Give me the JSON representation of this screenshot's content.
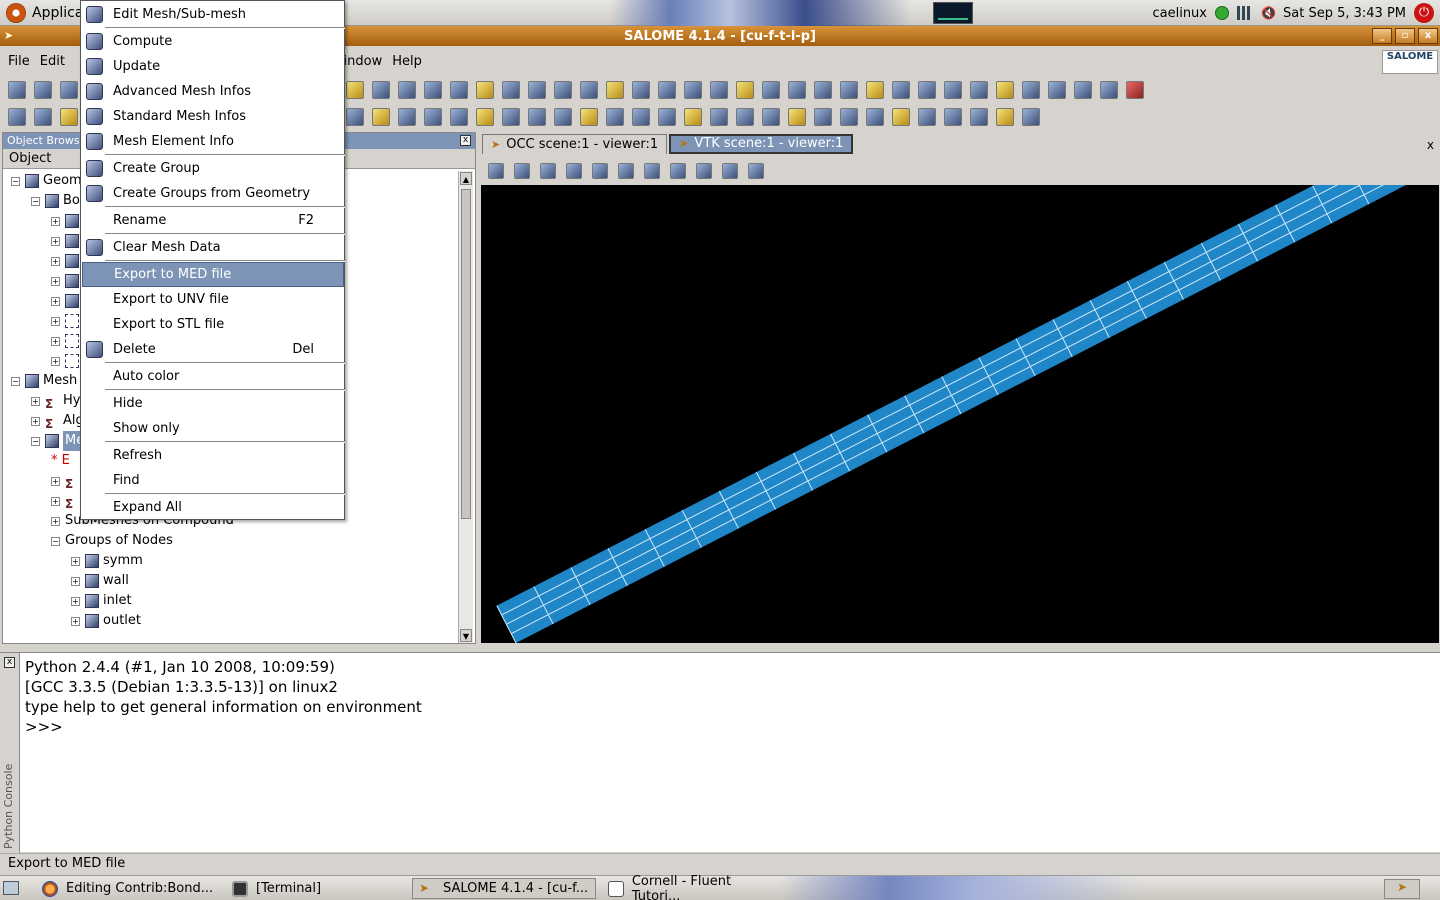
{
  "top_panel": {
    "applications_label": "Applications",
    "user": "caelinux",
    "clock": "Sat Sep  5,  3:43 PM"
  },
  "window": {
    "title": "SALOME 4.1.4 - [cu-f-t-l-p]",
    "buttons": [
      "_",
      "▫",
      "x"
    ]
  },
  "menubar": {
    "items": [
      "File",
      "Edit",
      "Window",
      "Help"
    ],
    "logo_text": "SALOME"
  },
  "object_browser": {
    "title": "Object Browser",
    "header": "Object",
    "tree": [
      {
        "label": "Geom",
        "indent": 0,
        "exp": "−",
        "icon": "geom"
      },
      {
        "label": "Box",
        "indent": 1,
        "exp": "−",
        "icon": "box"
      },
      {
        "label": "",
        "indent": 2,
        "exp": "+",
        "icon": "solid"
      },
      {
        "label": "",
        "indent": 2,
        "exp": "+",
        "icon": "solid"
      },
      {
        "label": "",
        "indent": 2,
        "exp": "+",
        "icon": "solid"
      },
      {
        "label": "",
        "indent": 2,
        "exp": "+",
        "icon": "solid"
      },
      {
        "label": "",
        "indent": 2,
        "exp": "+",
        "icon": "solid"
      },
      {
        "label": "",
        "indent": 2,
        "exp": "+",
        "icon": "dash"
      },
      {
        "label": "",
        "indent": 2,
        "exp": "+",
        "icon": "dash"
      },
      {
        "label": "",
        "indent": 2,
        "exp": "+",
        "icon": "dash"
      },
      {
        "label": "Mesh",
        "indent": 0,
        "exp": "−",
        "icon": "mesh"
      },
      {
        "label": "Hyp",
        "indent": 1,
        "exp": "+",
        "icon": "hyp"
      },
      {
        "label": "Alg",
        "indent": 1,
        "exp": "+",
        "icon": "hyp"
      },
      {
        "label": "Me",
        "indent": 1,
        "exp": "−",
        "icon": "mesh",
        "selected": true
      },
      {
        "label": "* E",
        "indent": 2,
        "exp": "",
        "icon": "none",
        "red": true
      },
      {
        "label": "",
        "indent": 2,
        "exp": "+",
        "icon": "hyp"
      },
      {
        "label": "",
        "indent": 2,
        "exp": "+",
        "icon": "hyp"
      },
      {
        "label": "SubMeshes on Compound",
        "indent": 2,
        "exp": "+",
        "icon": "none"
      },
      {
        "label": "Groups of Nodes",
        "indent": 2,
        "exp": "−",
        "icon": "none"
      },
      {
        "label": "symm",
        "indent": 3,
        "exp": "+",
        "icon": "mesh"
      },
      {
        "label": "wall",
        "indent": 3,
        "exp": "+",
        "icon": "mesh"
      },
      {
        "label": "inlet",
        "indent": 3,
        "exp": "+",
        "icon": "mesh"
      },
      {
        "label": "outlet",
        "indent": 3,
        "exp": "+",
        "icon": "mesh"
      }
    ]
  },
  "viewer": {
    "tabs": [
      {
        "label": "OCC scene:1 - viewer:1",
        "active": false
      },
      {
        "label": "VTK scene:1 - viewer:1",
        "active": true
      }
    ],
    "close_label": "x",
    "mesh_color": "#1f86c8",
    "background": "#000000"
  },
  "context_menu": {
    "items": [
      {
        "label": "Edit Mesh/Sub-mesh",
        "icon": "edit-mesh-icon"
      },
      {
        "sep": true
      },
      {
        "label": "Compute",
        "icon": "compute-icon"
      },
      {
        "label": "Update",
        "icon": "update-icon"
      },
      {
        "label": "Advanced Mesh Infos",
        "icon": "advanced-info-icon"
      },
      {
        "label": "Standard Mesh Infos",
        "icon": "standard-info-icon"
      },
      {
        "label": "Mesh Element Info",
        "icon": "element-info-icon"
      },
      {
        "sep": true
      },
      {
        "label": "Create Group",
        "icon": "create-group-icon"
      },
      {
        "label": "Create Groups from Geometry",
        "icon": "groups-geometry-icon"
      },
      {
        "sep": true
      },
      {
        "label": "Rename",
        "accel": "F2"
      },
      {
        "sep": true
      },
      {
        "label": "Clear Mesh Data",
        "icon": "clear-mesh-icon"
      },
      {
        "sep": true
      },
      {
        "label": "Export to MED file",
        "highlight": true
      },
      {
        "label": "Export to UNV file"
      },
      {
        "label": "Export to STL file"
      },
      {
        "label": "Delete",
        "accel": "Del",
        "icon": "delete-icon"
      },
      {
        "sep": true
      },
      {
        "label": "Auto color"
      },
      {
        "sep": true
      },
      {
        "label": "Hide"
      },
      {
        "label": "Show only"
      },
      {
        "sep": true
      },
      {
        "label": "Refresh"
      },
      {
        "label": "Find"
      },
      {
        "sep": true
      },
      {
        "label": "Expand All"
      }
    ]
  },
  "python_console": {
    "side_label": "Python Console",
    "lines": [
      "Python 2.4.4 (#1, Jan 10 2008, 10:09:59)",
      "[GCC 3.3.5 (Debian 1:3.3.5-13)] on linux2",
      "type help to get general information on environment",
      ">>>"
    ]
  },
  "status_bar": {
    "text": "Export to MED file"
  },
  "taskbar": {
    "tasks": [
      {
        "label": "Editing Contrib:Bond...",
        "icon": "firefox-icon"
      },
      {
        "label": "[Terminal]",
        "icon": "terminal-icon"
      },
      {
        "label": "SALOME 4.1.4 - [cu-f...",
        "icon": "salome-icon",
        "active": true
      },
      {
        "label": "Cornell - Fluent Tutori...",
        "icon": "document-icon"
      }
    ]
  }
}
